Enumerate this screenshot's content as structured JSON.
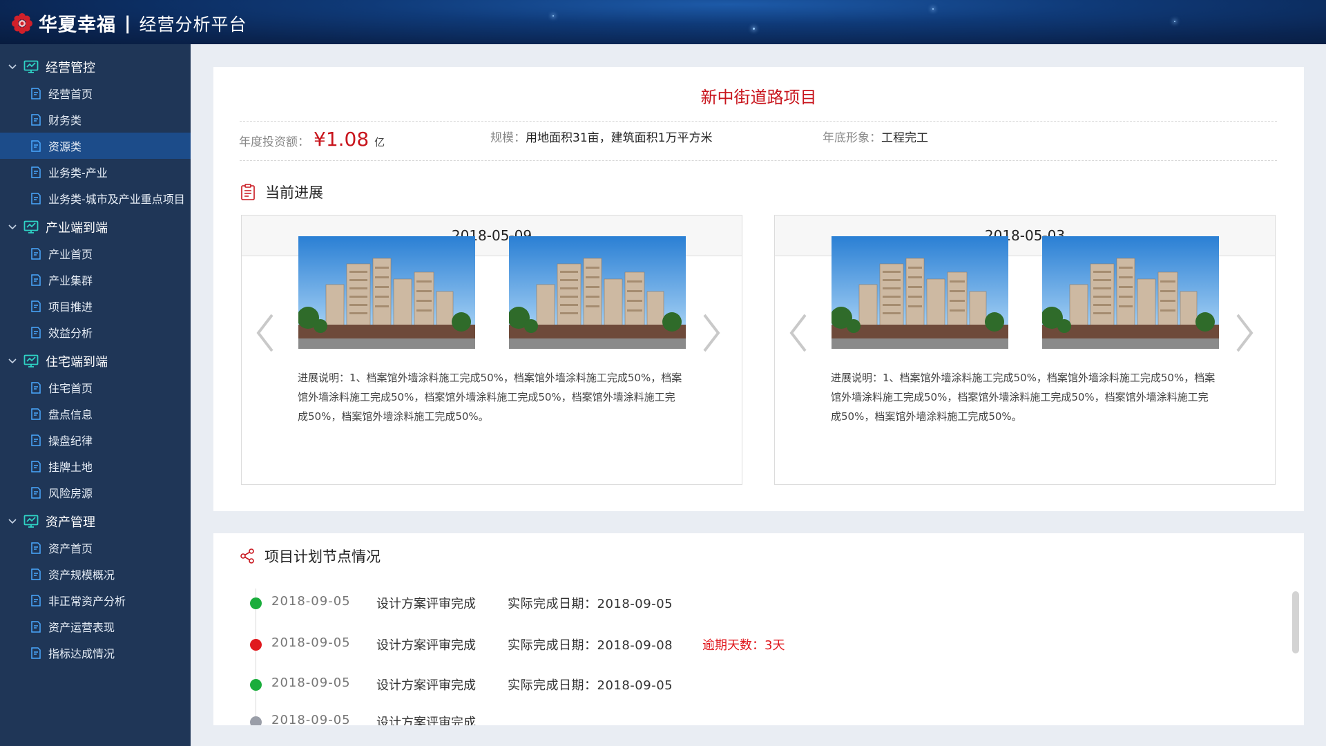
{
  "header": {
    "brand": "华夏幸福",
    "separator": "|",
    "platform": "经营分析平台"
  },
  "sidebar": {
    "groups": [
      {
        "label": "经营管控",
        "items": [
          {
            "label": "经营首页"
          },
          {
            "label": "财务类"
          },
          {
            "label": "资源类",
            "active": true
          },
          {
            "label": "业务类-产业"
          },
          {
            "label": "业务类-城市及产业重点项目"
          }
        ]
      },
      {
        "label": "产业端到端",
        "items": [
          {
            "label": "产业首页"
          },
          {
            "label": "产业集群"
          },
          {
            "label": "项目推进"
          },
          {
            "label": "效益分析"
          }
        ]
      },
      {
        "label": "住宅端到端",
        "items": [
          {
            "label": "住宅首页"
          },
          {
            "label": "盘点信息"
          },
          {
            "label": "操盘纪律"
          },
          {
            "label": "挂牌土地"
          },
          {
            "label": "风险房源"
          }
        ]
      },
      {
        "label": "资产管理",
        "items": [
          {
            "label": "资产首页"
          },
          {
            "label": "资产规模概况"
          },
          {
            "label": "非正常资产分析"
          },
          {
            "label": "资产运营表现"
          },
          {
            "label": "指标达成情况"
          }
        ]
      }
    ]
  },
  "project": {
    "title": "新中街道路项目",
    "investment_label": "年度投资额：",
    "investment_value": "¥1.08",
    "investment_unit": "亿",
    "scale_label": "规模：",
    "scale_value": "用地面积31亩，建筑面积1万平方米",
    "image_label": "年底形象：",
    "image_value": "工程完工"
  },
  "progress": {
    "title": "当前进展",
    "panels": [
      {
        "date": "2018-05-09",
        "desc": "进展说明：1、档案馆外墙涂料施工完成50%，档案馆外墙涂料施工完成50%，档案馆外墙涂料施工完成50%，档案馆外墙涂料施工完成50%，档案馆外墙涂料施工完成50%，档案馆外墙涂料施工完成50%。"
      },
      {
        "date": "2018-05-03",
        "desc": "进展说明：1、档案馆外墙涂料施工完成50%，档案馆外墙涂料施工完成50%，档案馆外墙涂料施工完成50%，档案馆外墙涂料施工完成50%，档案馆外墙涂料施工完成50%，档案馆外墙涂料施工完成50%。"
      }
    ]
  },
  "plan": {
    "title": "项目计划节点情况",
    "nodes": [
      {
        "date": "2018-09-05",
        "name": "设计方案评审完成",
        "actual": "实际完成日期：2018-09-05",
        "overdue": "",
        "status_color": "#1aad3c"
      },
      {
        "date": "2018-09-05",
        "name": "设计方案评审完成",
        "actual": "实际完成日期：2018-09-08",
        "overdue": "逾期天数：3天",
        "status_color": "#e0191e"
      },
      {
        "date": "2018-09-05",
        "name": "设计方案评审完成",
        "actual": "实际完成日期：2018-09-05",
        "overdue": "",
        "status_color": "#1aad3c"
      },
      {
        "date": "2018-09-05",
        "name": "设计方案评审完成",
        "actual": "",
        "overdue": "",
        "status_color": "#9a9ea8"
      }
    ]
  },
  "colors": {
    "accent_red": "#c8141c",
    "sidebar_bg": "#1f3657",
    "sidebar_active": "#1c4c8a",
    "icon_teal": "#2fd3c5"
  }
}
